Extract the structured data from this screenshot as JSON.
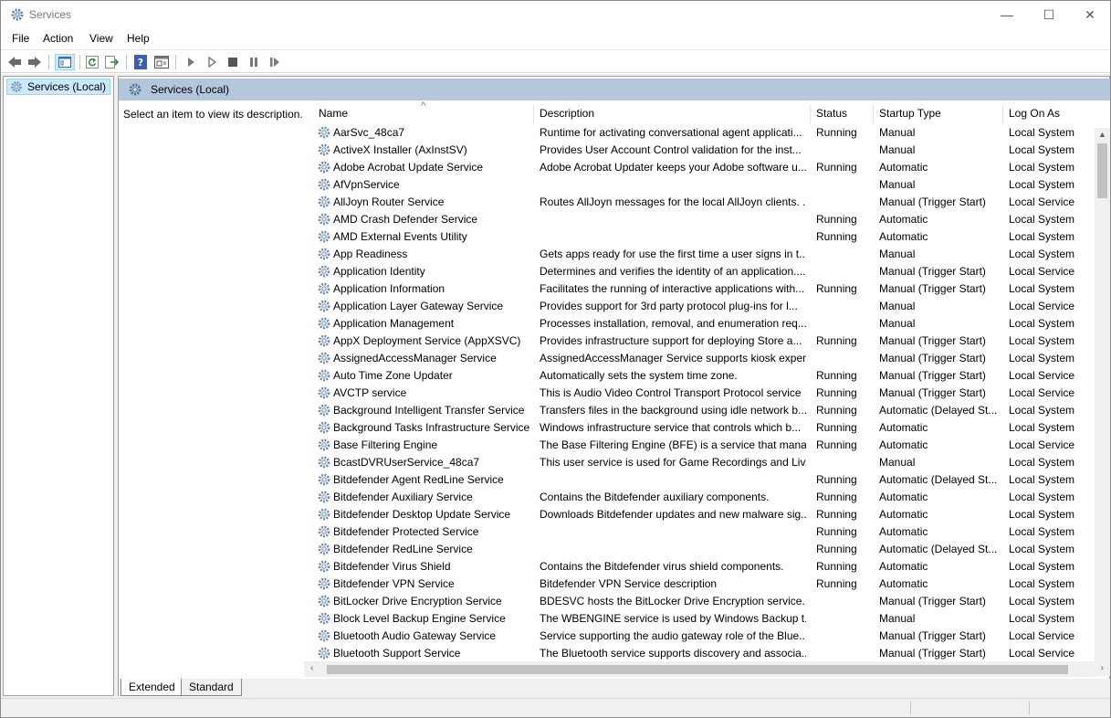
{
  "window": {
    "title": "Services",
    "minimize_glyph": "—",
    "maximize_glyph": "☐",
    "close_glyph": "✕"
  },
  "menu": [
    "File",
    "Action",
    "View",
    "Help"
  ],
  "toolbar": {
    "icons": [
      "back-icon",
      "forward-icon",
      "show-hide-console-tree-icon",
      "refresh-icon",
      "export-list-icon",
      "help-icon",
      "properties-icon",
      "start-service-icon",
      "start-service-alt-icon",
      "stop-service-icon",
      "pause-service-icon",
      "resume-service-icon"
    ]
  },
  "tree": {
    "root_label": "Services (Local)"
  },
  "main": {
    "header_title": "Services (Local)",
    "description_prompt": "Select an item to view its description.",
    "columns": [
      "Name",
      "Description",
      "Status",
      "Startup Type",
      "Log On As"
    ],
    "sort_indicator": "^",
    "rows": [
      [
        "AarSvc_48ca7",
        "Runtime for activating conversational agent applicati...",
        "Running",
        "Manual",
        "Local System"
      ],
      [
        "ActiveX Installer (AxInstSV)",
        "Provides User Account Control validation for the inst...",
        "",
        "Manual",
        "Local System"
      ],
      [
        "Adobe Acrobat Update Service",
        "Adobe Acrobat Updater keeps your Adobe software u...",
        "Running",
        "Automatic",
        "Local System"
      ],
      [
        "AfVpnService",
        "",
        "",
        "Manual",
        "Local System"
      ],
      [
        "AllJoyn Router Service",
        "Routes AllJoyn messages for the local AllJoyn clients. ...",
        "",
        "Manual (Trigger Start)",
        "Local Service"
      ],
      [
        "AMD Crash Defender Service",
        "",
        "Running",
        "Automatic",
        "Local System"
      ],
      [
        "AMD External Events Utility",
        "",
        "Running",
        "Automatic",
        "Local System"
      ],
      [
        "App Readiness",
        "Gets apps ready for use the first time a user signs in t...",
        "",
        "Manual",
        "Local System"
      ],
      [
        "Application Identity",
        "Determines and verifies the identity of an application....",
        "",
        "Manual (Trigger Start)",
        "Local Service"
      ],
      [
        "Application Information",
        "Facilitates the running of interactive applications with...",
        "Running",
        "Manual (Trigger Start)",
        "Local System"
      ],
      [
        "Application Layer Gateway Service",
        "Provides support for 3rd party protocol plug-ins for l...",
        "",
        "Manual",
        "Local Service"
      ],
      [
        "Application Management",
        "Processes installation, removal, and enumeration req...",
        "",
        "Manual",
        "Local System"
      ],
      [
        "AppX Deployment Service (AppXSVC)",
        "Provides infrastructure support for deploying Store a...",
        "Running",
        "Manual (Trigger Start)",
        "Local System"
      ],
      [
        "AssignedAccessManager Service",
        "AssignedAccessManager Service supports kiosk exper...",
        "",
        "Manual (Trigger Start)",
        "Local System"
      ],
      [
        "Auto Time Zone Updater",
        "Automatically sets the system time zone.",
        "Running",
        "Manual (Trigger Start)",
        "Local Service"
      ],
      [
        "AVCTP service",
        "This is Audio Video Control Transport Protocol service",
        "Running",
        "Manual (Trigger Start)",
        "Local Service"
      ],
      [
        "Background Intelligent Transfer Service",
        "Transfers files in the background using idle network b...",
        "Running",
        "Automatic (Delayed St...",
        "Local System"
      ],
      [
        "Background Tasks Infrastructure Service",
        "Windows infrastructure service that controls which b...",
        "Running",
        "Automatic",
        "Local System"
      ],
      [
        "Base Filtering Engine",
        "The Base Filtering Engine (BFE) is a service that mana...",
        "Running",
        "Automatic",
        "Local Service"
      ],
      [
        "BcastDVRUserService_48ca7",
        "This user service is used for Game Recordings and Liv...",
        "",
        "Manual",
        "Local System"
      ],
      [
        "Bitdefender Agent RedLine Service",
        "",
        "Running",
        "Automatic (Delayed St...",
        "Local System"
      ],
      [
        "Bitdefender Auxiliary Service",
        "Contains the Bitdefender auxiliary components.",
        "Running",
        "Automatic",
        "Local System"
      ],
      [
        "Bitdefender Desktop Update Service",
        "Downloads Bitdefender updates and new malware sig...",
        "Running",
        "Automatic",
        "Local System"
      ],
      [
        "Bitdefender Protected Service",
        "",
        "Running",
        "Automatic",
        "Local System"
      ],
      [
        "Bitdefender RedLine Service",
        "",
        "Running",
        "Automatic (Delayed St...",
        "Local System"
      ],
      [
        "Bitdefender Virus Shield",
        "Contains the Bitdefender virus shield components.",
        "Running",
        "Automatic",
        "Local System"
      ],
      [
        "Bitdefender VPN Service",
        "Bitdefender VPN Service description",
        "Running",
        "Automatic",
        "Local System"
      ],
      [
        "BitLocker Drive Encryption Service",
        "BDESVC hosts the BitLocker Drive Encryption service. ...",
        "",
        "Manual (Trigger Start)",
        "Local System"
      ],
      [
        "Block Level Backup Engine Service",
        "The WBENGINE service is used by Windows Backup t...",
        "",
        "Manual",
        "Local System"
      ],
      [
        "Bluetooth Audio Gateway Service",
        "Service supporting the audio gateway role of the Blue...",
        "",
        "Manual (Trigger Start)",
        "Local Service"
      ],
      [
        "Bluetooth Support Service",
        "The Bluetooth service supports discovery and associa...",
        "",
        "Manual (Trigger Start)",
        "Local Service"
      ]
    ]
  },
  "tabs": [
    "Extended",
    "Standard"
  ],
  "colors": {
    "header_bg": "#b4c6dc",
    "selection_bg": "#cce8ff"
  }
}
